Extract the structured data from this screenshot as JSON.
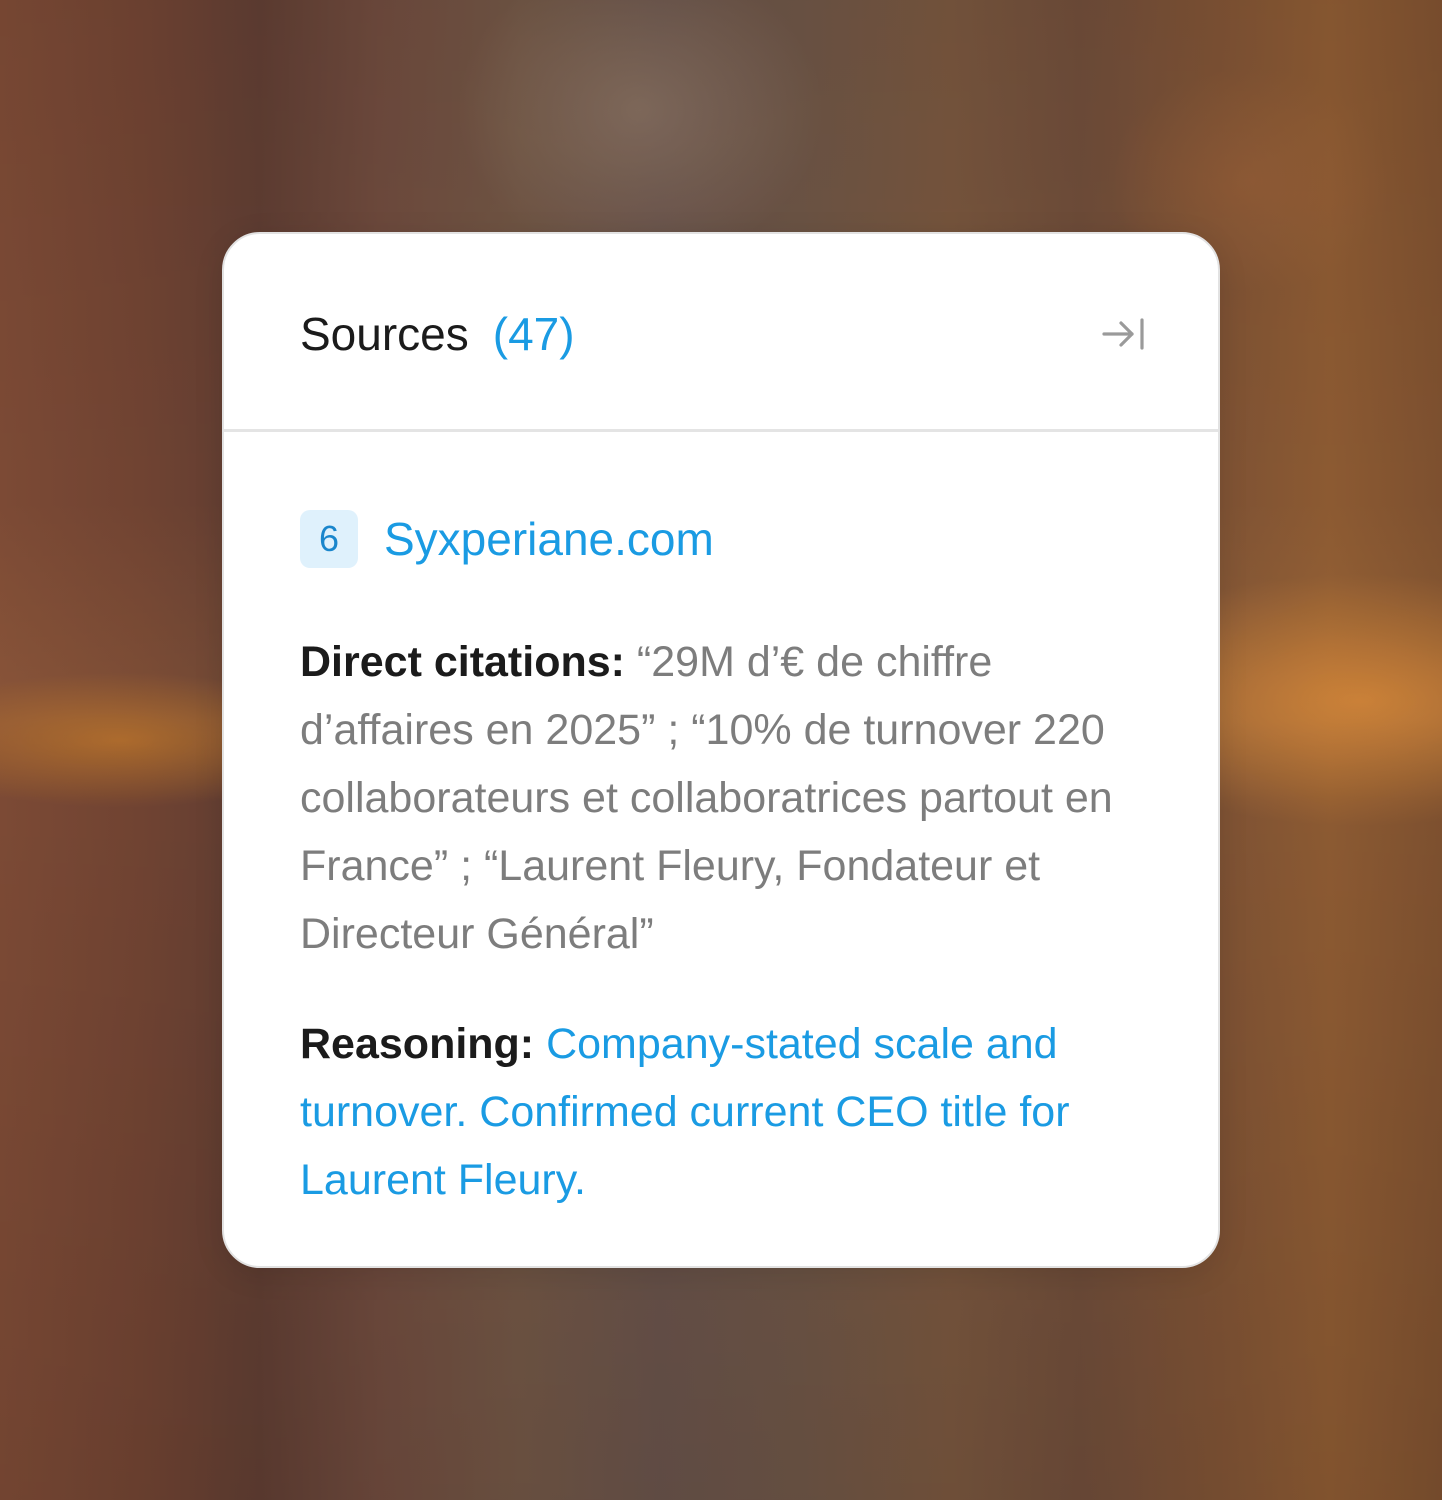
{
  "panel": {
    "title": "Sources",
    "count": "(47)",
    "collapse_icon": "arrow-right-to-line-icon"
  },
  "source": {
    "index": "6",
    "name": "Syxperiane.com",
    "direct_citations_label": "Direct citations:",
    "direct_citations_text": "“29M d’€ de chiffre d’affaires en 2025” ; “10% de turnover 220 collaborateurs et collaboratrices partout en France” ; “Laurent Fleury, Fondateur et Directeur Général”",
    "reasoning_label": "Reasoning:",
    "reasoning_text": "Company-stated scale and turnover. Confirmed current CEO title for Laurent Fleury."
  },
  "colors": {
    "accent": "#1a9be3",
    "badge_bg": "#dff1fc",
    "muted_text": "#7d7d7d",
    "primary_text": "#1b1b1b"
  }
}
